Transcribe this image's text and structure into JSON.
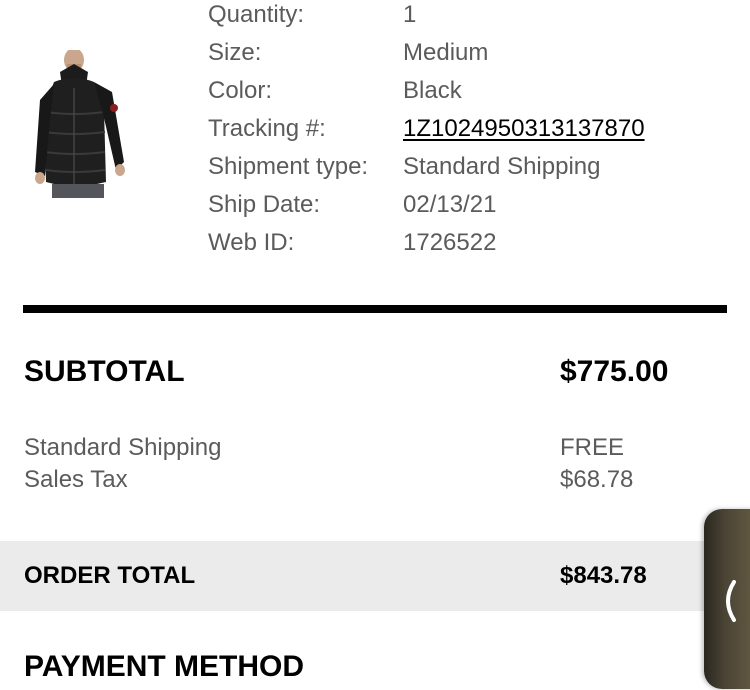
{
  "item_details": [
    {
      "label": "Quantity:",
      "value": "1"
    },
    {
      "label": "Size:",
      "value": "Medium"
    },
    {
      "label": "Color:",
      "value": "Black"
    },
    {
      "label": "Tracking #:",
      "value": "1Z1024950313137870"
    },
    {
      "label": "Shipment type:",
      "value": "Standard Shipping"
    },
    {
      "label": "Ship Date:",
      "value": "02/13/21"
    },
    {
      "label": "Web ID:",
      "value": "1726522"
    }
  ],
  "summary": {
    "subtotal_label": "SUBTOTAL",
    "subtotal_value": "$775.00",
    "charges": [
      {
        "label": "Standard Shipping",
        "value": "FREE"
      },
      {
        "label": "Sales Tax",
        "value": "$68.78"
      }
    ],
    "order_total_label": "ORDER TOTAL",
    "order_total_value": "$843.78"
  },
  "payment": {
    "heading": "PAYMENT METHOD"
  },
  "icons": {
    "product_image": "black-puffer-jacket-image",
    "side_tab": "chevron-left-icon"
  },
  "colors": {
    "label_gray": "#5b5b5b",
    "divider": "#000000",
    "order_total_band": "#ebebeb",
    "side_tab": "#4a4434"
  }
}
